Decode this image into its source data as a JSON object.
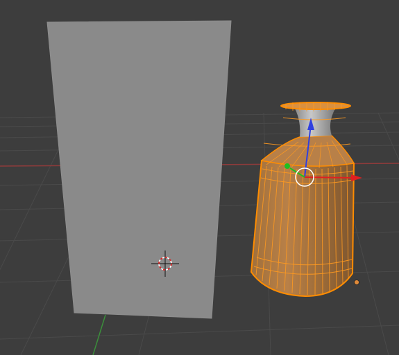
{
  "viewport": {
    "view": "perspective-3d",
    "background_color": "#3d3d3d",
    "grid_color": "#4a4a4a",
    "x_axis_color": "#8f3b3b",
    "y_axis_color": "#3b8f3b"
  },
  "objects": [
    {
      "name": "plane",
      "type": "plane",
      "selected": false,
      "color": "#8a8a8a"
    },
    {
      "name": "bottle",
      "type": "mesh",
      "selected": true,
      "edit_mode": true,
      "select_color": "#ff8c00",
      "unselected_color": "#9a9a9a"
    }
  ],
  "gizmo": {
    "type": "translate",
    "x_color": "#e02020",
    "y_color": "#20c020",
    "z_color": "#3040e0"
  },
  "cursor_3d": {
    "colors": [
      "#e02020",
      "#ffffff"
    ]
  }
}
